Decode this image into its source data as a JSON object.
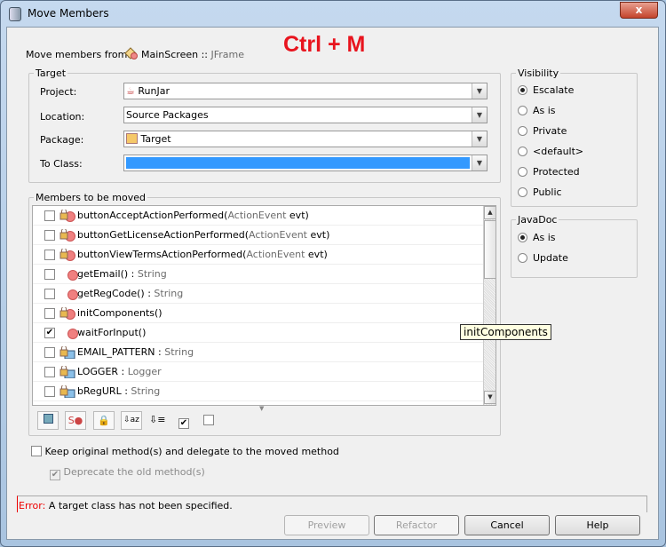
{
  "window": {
    "title": "Move Members",
    "close": "x"
  },
  "overlay": {
    "shortcut": "Ctrl + M",
    "color": "#e8141e"
  },
  "from": {
    "label": "Move members from:",
    "class": "MainScreen",
    "sep": "::",
    "super": "JFrame"
  },
  "target": {
    "title": "Target",
    "project": {
      "label": "Project:",
      "value": "RunJar"
    },
    "location": {
      "label": "Location:",
      "value": "Source Packages"
    },
    "package": {
      "label": "Package:",
      "value": "Target"
    },
    "to_class": {
      "label": "To Class:",
      "value": ""
    }
  },
  "visibility": {
    "title": "Visibility",
    "options": [
      "Escalate",
      "As is",
      "Private",
      "<default>",
      "Protected",
      "Public"
    ],
    "selected": "Escalate"
  },
  "javadoc": {
    "title": "JavaDoc",
    "options": [
      "As is",
      "Update"
    ],
    "selected": "As is"
  },
  "members": {
    "title": "Members to be moved",
    "items": [
      {
        "name": "buttonAcceptActionPerformed(",
        "type": "ActionEvent",
        "rest": " evt)",
        "checked": false,
        "kind": "private-method"
      },
      {
        "name": "buttonGetLicenseActionPerformed(",
        "type": "ActionEvent",
        "rest": " evt)",
        "checked": false,
        "kind": "private-method"
      },
      {
        "name": "buttonViewTermsActionPerformed(",
        "type": "ActionEvent",
        "rest": " evt)",
        "checked": false,
        "kind": "private-method"
      },
      {
        "name": "getEmail() : ",
        "type": "String",
        "rest": "",
        "checked": false,
        "kind": "method"
      },
      {
        "name": "getRegCode() : ",
        "type": "String",
        "rest": "",
        "checked": false,
        "kind": "method"
      },
      {
        "name": "initComponents()",
        "type": "",
        "rest": "",
        "checked": false,
        "kind": "private-method"
      },
      {
        "name": "waitForInput()",
        "type": "",
        "rest": "",
        "checked": true,
        "kind": "method"
      },
      {
        "name": "EMAIL_PATTERN : ",
        "type": "String",
        "rest": "",
        "checked": false,
        "kind": "private-static-field"
      },
      {
        "name": "LOGGER : ",
        "type": "Logger",
        "rest": "",
        "checked": false,
        "kind": "private-field"
      },
      {
        "name": "bRegURL : ",
        "type": "String",
        "rest": "",
        "checked": false,
        "kind": "private-field"
      }
    ],
    "tooltip": "initComponents"
  },
  "options": {
    "keep": {
      "label": "Keep original method(s) and delegate to the moved method",
      "checked": false
    },
    "deprecate": {
      "label": "Deprecate the old method(s)",
      "checked": true,
      "disabled": true
    }
  },
  "status": {
    "prefix": "Error:",
    "message": " A target class has not been specified."
  },
  "buttons": {
    "preview": "Preview",
    "refactor": "Refactor",
    "cancel": "Cancel",
    "help": "Help"
  }
}
